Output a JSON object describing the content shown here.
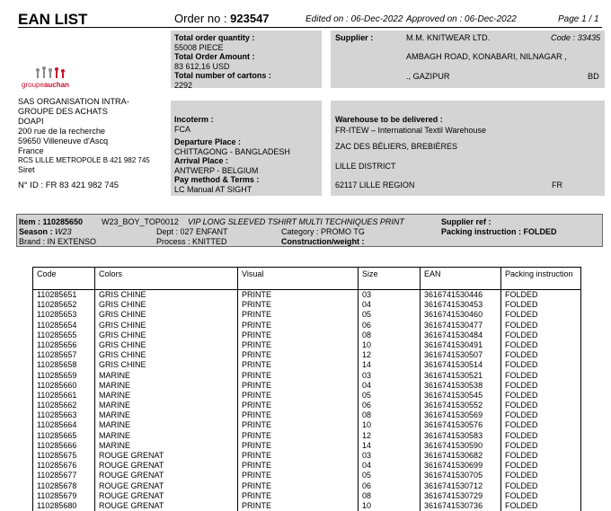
{
  "header": {
    "title": "EAN LIST",
    "order_label": "Order no :",
    "order_no": "923547",
    "edited": "Edited on : 06-Dec-2022",
    "approved": "Approved on : 06-Dec-2022",
    "page": "Page  1  / 1"
  },
  "buyer": {
    "logo_text_a": "groupe",
    "logo_text_b": "auchan",
    "address_lines": [
      "SAS ORGANISATION INTRA-",
      "GROUPE DES ACHATS",
      "DOAPI",
      "200 rue de la recherche",
      "59650 Villeneuve d'Ascq",
      "France"
    ],
    "rcs": "RCS LILLE METROPOLE B 421 982 745",
    "siret": "Siret",
    "nid": "N° ID : FR 83 421 982 745"
  },
  "totals": {
    "qty_label": "Total order quantity :",
    "qty": "55008 PIECE",
    "amount_label": "Total Order Amount :",
    "amount": "83 612,16 USD",
    "cartons_label": "Total number of cartons :",
    "cartons": "2292"
  },
  "supplier": {
    "label": "Supplier  :",
    "name": "M.M. KNITWEAR LTD.",
    "code": "Code : 33435",
    "addr1": "AMBAGH ROAD, KONABARI, NILNAGAR ,",
    "addr2": "., GAZIPUR",
    "country": "BD"
  },
  "terms": {
    "incoterm_label": "Incoterm :",
    "incoterm": "FCA",
    "departure_label": "Departure Place :",
    "departure": "CHITTAGONG - BANGLADESH",
    "arrival_label": "Arrival Place :",
    "arrival": "ANTWERP - BELGIUM",
    "pay_label": "Pay method & Terms :",
    "pay": "LC Manual AT SIGHT"
  },
  "warehouse": {
    "label": "Warehouse to be delivered :",
    "line1": "FR-ITEW – International Textil Warehouse",
    "line2": "ZAC DES BÉLIERS, BREBIÈRES",
    "line3": "LILLE DISTRICT",
    "line4": "62117 LILLE REGION",
    "country": "FR"
  },
  "item": {
    "item": "Item : 110285650",
    "ref": "W23_BOY_TOP0012",
    "desc": "VIP LONG SLEEVED TSHIRT MULTI TECHNIQUES PRINT",
    "supplier_ref": "Supplier ref :",
    "season_label": "Season :",
    "season": "W23",
    "dept": "Dept : 027  ENFANT",
    "category": "Category : PROMO TG",
    "packing": "Packing instruction : FOLDED",
    "brand": "Brand : IN EXTENSO",
    "process": "Process : KNITTED",
    "construction": "Construction/weight :"
  },
  "table": {
    "headers": [
      "Code",
      "Colors",
      "Visual",
      "Size",
      "EAN",
      "Packing instruction"
    ],
    "rows": [
      [
        "110285651",
        "GRIS CHINE",
        "PRINTE",
        "03",
        "3616741530446",
        "FOLDED"
      ],
      [
        "110285652",
        "GRIS CHINE",
        "PRINTE",
        "04",
        "3616741530453",
        "FOLDED"
      ],
      [
        "110285653",
        "GRIS CHINE",
        "PRINTE",
        "05",
        "3616741530460",
        "FOLDED"
      ],
      [
        "110285654",
        "GRIS CHINE",
        "PRINTE",
        "06",
        "3616741530477",
        "FOLDED"
      ],
      [
        "110285655",
        "GRIS CHINE",
        "PRINTE",
        "08",
        "3616741530484",
        "FOLDED"
      ],
      [
        "110285656",
        "GRIS CHINE",
        "PRINTE",
        "10",
        "3616741530491",
        "FOLDED"
      ],
      [
        "110285657",
        "GRIS CHINE",
        "PRINTE",
        "12",
        "3616741530507",
        "FOLDED"
      ],
      [
        "110285658",
        "GRIS CHINE",
        "PRINTE",
        "14",
        "3616741530514",
        "FOLDED"
      ],
      [
        "110285659",
        "MARINE",
        "PRINTE",
        "03",
        "3616741530521",
        "FOLDED"
      ],
      [
        "110285660",
        "MARINE",
        "PRINTE",
        "04",
        "3616741530538",
        "FOLDED"
      ],
      [
        "110285661",
        "MARINE",
        "PRINTE",
        "05",
        "3616741530545",
        "FOLDED"
      ],
      [
        "110285662",
        "MARINE",
        "PRINTE",
        "06",
        "3616741530552",
        "FOLDED"
      ],
      [
        "110285663",
        "MARINE",
        "PRINTE",
        "08",
        "3616741530569",
        "FOLDED"
      ],
      [
        "110285664",
        "MARINE",
        "PRINTE",
        "10",
        "3616741530576",
        "FOLDED"
      ],
      [
        "110285665",
        "MARINE",
        "PRINTE",
        "12",
        "3616741530583",
        "FOLDED"
      ],
      [
        "110285666",
        "MARINE",
        "PRINTE",
        "14",
        "3616741530590",
        "FOLDED"
      ],
      [
        "110285675",
        "ROUGE GRENAT",
        "PRINTE",
        "03",
        "3616741530682",
        "FOLDED"
      ],
      [
        "110285676",
        "ROUGE GRENAT",
        "PRINTE",
        "04",
        "3616741530699",
        "FOLDED"
      ],
      [
        "110285677",
        "ROUGE GRENAT",
        "PRINTE",
        "05",
        "3616741530705",
        "FOLDED"
      ],
      [
        "110285678",
        "ROUGE GRENAT",
        "PRINTE",
        "06",
        "3616741530712",
        "FOLDED"
      ],
      [
        "110285679",
        "ROUGE GRENAT",
        "PRINTE",
        "08",
        "3616741530729",
        "FOLDED"
      ],
      [
        "110285680",
        "ROUGE GRENAT",
        "PRINTE",
        "10",
        "3616741530736",
        "FOLDED"
      ]
    ]
  }
}
